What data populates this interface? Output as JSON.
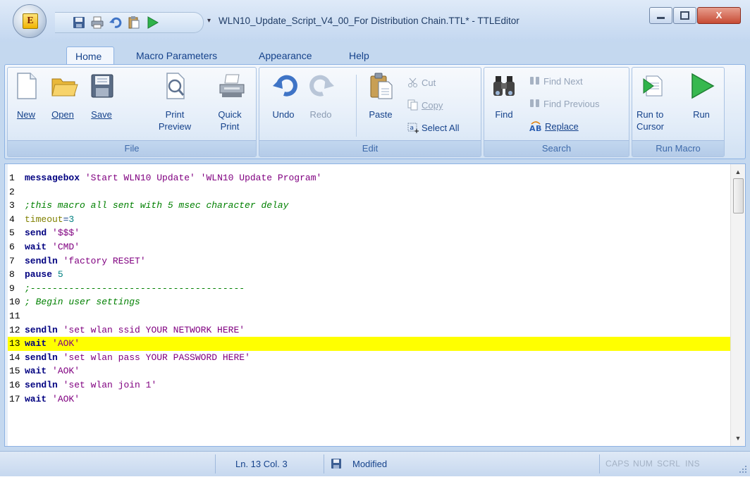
{
  "window": {
    "title": "WLN10_Update_Script_V4_00_For Distribution Chain.TTL* - TTLEditor",
    "app_logo_letter": "E",
    "controls": {
      "minimize_icon": "minimize-icon",
      "maximize_icon": "maximize-icon",
      "close_label": "X"
    }
  },
  "quick_access": [
    "save-icon",
    "print-icon",
    "undo-icon",
    "paste-icon",
    "run-icon"
  ],
  "tabs": [
    {
      "label": "Home",
      "active": true
    },
    {
      "label": "Macro Parameters",
      "active": false
    },
    {
      "label": "Appearance",
      "active": false
    },
    {
      "label": "Help",
      "active": false
    }
  ],
  "ribbon": {
    "file": {
      "label": "File",
      "new": "New",
      "open": "Open",
      "save": "Save",
      "print_preview_1": "Print",
      "print_preview_2": "Preview",
      "quick_print_1": "Quick",
      "quick_print_2": "Print"
    },
    "edit": {
      "label": "Edit",
      "undo": "Undo",
      "redo": "Redo",
      "paste": "Paste",
      "cut": "Cut",
      "copy": "Copy",
      "select_all": "Select All"
    },
    "search": {
      "label": "Search",
      "find": "Find",
      "find_next": "Find Next",
      "find_previous": "Find Previous",
      "replace": "Replace"
    },
    "run_macro": {
      "label": "Run Macro",
      "run_to_cursor_1": "Run to",
      "run_to_cursor_2": "Cursor",
      "run": "Run"
    }
  },
  "editor": {
    "highlighted_line": 13,
    "lines": [
      {
        "n": "1",
        "tokens": [
          [
            "kw",
            "messagebox"
          ],
          [
            "t",
            " "
          ],
          [
            "str",
            "'Start WLN10 Update'"
          ],
          [
            "t",
            " "
          ],
          [
            "str",
            "'WLN10 Update Program'"
          ]
        ]
      },
      {
        "n": "2",
        "tokens": []
      },
      {
        "n": "3",
        "tokens": [
          [
            "cmt",
            ";this macro all sent with 5 msec character delay"
          ]
        ]
      },
      {
        "n": "4",
        "tokens": [
          [
            "var",
            "timeout"
          ],
          [
            "t",
            "="
          ],
          [
            "num",
            "3"
          ]
        ]
      },
      {
        "n": "5",
        "tokens": [
          [
            "kw",
            "send"
          ],
          [
            "t",
            " "
          ],
          [
            "str",
            "'$$$'"
          ]
        ]
      },
      {
        "n": "6",
        "tokens": [
          [
            "kw",
            "wait"
          ],
          [
            "t",
            " "
          ],
          [
            "str",
            "'CMD'"
          ]
        ]
      },
      {
        "n": "7",
        "tokens": [
          [
            "kw",
            "sendln"
          ],
          [
            "t",
            " "
          ],
          [
            "str",
            "'factory RESET'"
          ]
        ]
      },
      {
        "n": "8",
        "tokens": [
          [
            "kw",
            "pause"
          ],
          [
            "t",
            " "
          ],
          [
            "num",
            "5"
          ]
        ]
      },
      {
        "n": "9",
        "tokens": [
          [
            "cmt",
            ";---------------------------------------"
          ]
        ]
      },
      {
        "n": "10",
        "tokens": [
          [
            "cmt",
            "; Begin user settings"
          ]
        ]
      },
      {
        "n": "11",
        "tokens": []
      },
      {
        "n": "12",
        "tokens": [
          [
            "kw",
            "sendln"
          ],
          [
            "t",
            " "
          ],
          [
            "str",
            "'set wlan ssid YOUR NETWORK HERE'"
          ]
        ]
      },
      {
        "n": "13",
        "tokens": [
          [
            "kw",
            "wait"
          ],
          [
            "t",
            " "
          ],
          [
            "str",
            "'AOK'"
          ]
        ]
      },
      {
        "n": "14",
        "tokens": [
          [
            "kw",
            "sendln"
          ],
          [
            "t",
            " "
          ],
          [
            "str",
            "'set wlan pass YOUR PASSWORD HERE'"
          ]
        ]
      },
      {
        "n": "15",
        "tokens": [
          [
            "kw",
            "wait"
          ],
          [
            "t",
            " "
          ],
          [
            "str",
            "'AOK'"
          ]
        ]
      },
      {
        "n": "16",
        "tokens": [
          [
            "kw",
            "sendln"
          ],
          [
            "t",
            " "
          ],
          [
            "str",
            "'set wlan join 1'"
          ]
        ]
      },
      {
        "n": "17",
        "tokens": [
          [
            "kw",
            "wait"
          ],
          [
            "t",
            " "
          ],
          [
            "str",
            "'AOK'"
          ]
        ]
      }
    ]
  },
  "status": {
    "position": "Ln. 13  Col. 3",
    "state": "Modified",
    "caps": "CAPS",
    "num": "NUM",
    "scrl": "SCRL",
    "ins": "INS"
  },
  "colors": {
    "keyword": "#000080",
    "string": "#800080",
    "comment": "#008000",
    "variable": "#808000",
    "number": "#008080",
    "highlight": "#ffff00"
  }
}
